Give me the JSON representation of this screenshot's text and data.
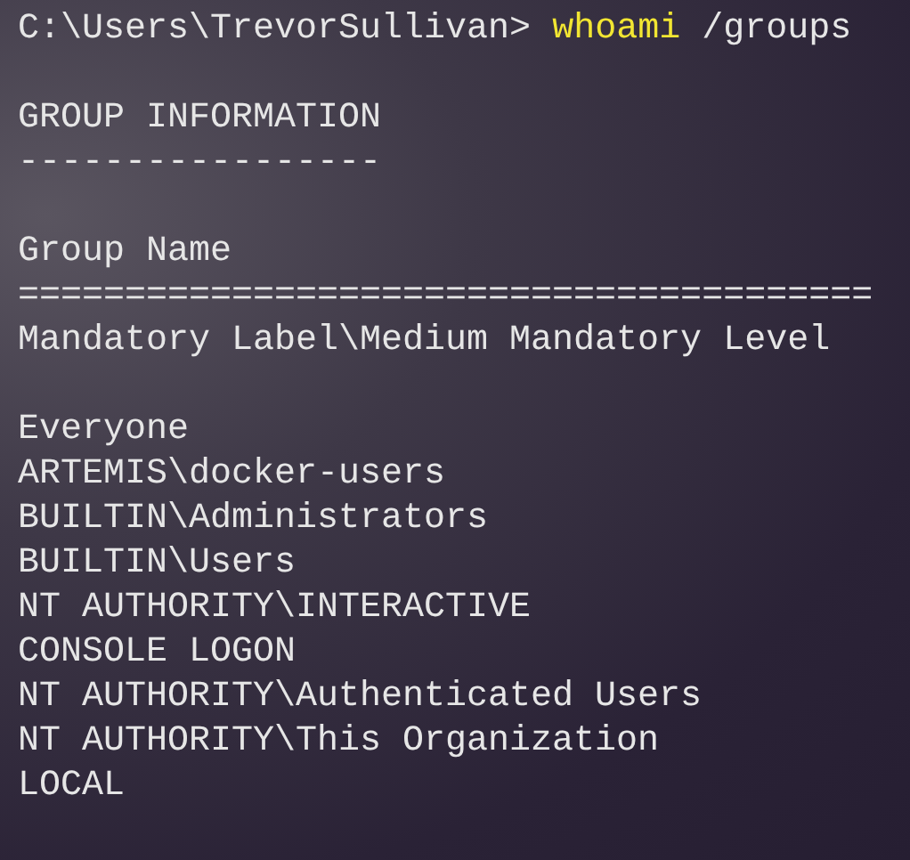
{
  "prompt": {
    "path": "C:\\Users\\TrevorSullivan>",
    "command": "whoami",
    "args": "/groups"
  },
  "section_title": "GROUP INFORMATION",
  "section_underline": "-----------------",
  "column_heading": "Group Name",
  "column_rule": "========================================",
  "groups": [
    {
      "kind": "label",
      "name": "Mandatory Label\\Medium Mandatory Level"
    },
    {
      "kind": "group",
      "name": "Everyone"
    },
    {
      "kind": "group",
      "name": "ARTEMIS\\docker-users"
    },
    {
      "kind": "group",
      "name": "BUILTIN\\Administrators"
    },
    {
      "kind": "group",
      "name": "BUILTIN\\Users"
    },
    {
      "kind": "group",
      "name": "NT AUTHORITY\\INTERACTIVE"
    },
    {
      "kind": "group",
      "name": "CONSOLE LOGON"
    },
    {
      "kind": "group",
      "name": "NT AUTHORITY\\Authenticated Users"
    },
    {
      "kind": "group",
      "name": "NT AUTHORITY\\This Organization"
    },
    {
      "kind": "group",
      "name": "LOCAL"
    }
  ]
}
